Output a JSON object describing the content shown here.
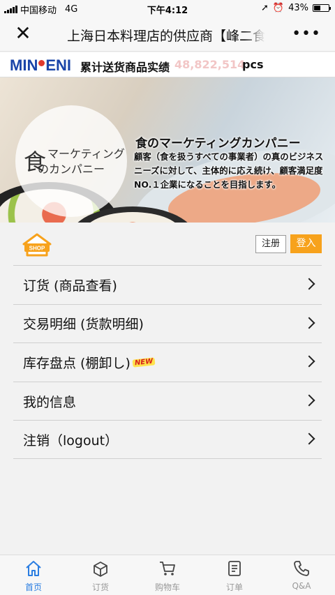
{
  "status_bar": {
    "carrier": "中国移动",
    "network": "4G",
    "time": "下午4:12",
    "battery": "43%",
    "battery_level": 0.43
  },
  "nav": {
    "title": "上海日本料理店的供应商【峰二食"
  },
  "brand": {
    "logo": "MINENI",
    "delivered_label": "累计送货商品实绩",
    "delivered_count": "48,822,514",
    "delivered_unit": "pcs"
  },
  "banner": {
    "circle_text_kanji": "食",
    "circle_text_line1": "マーケティング",
    "circle_text_line2": "のカンパニー",
    "headline": "食のマーケティングカンパニー",
    "description": "顧客（食を扱うすべての事業者）の真のビジネスニーズに対して、主体的に応え続け、顧客満足度NO.１企業になることを目指します。"
  },
  "shop": {
    "icon_label": "SHOP",
    "register": "注册",
    "login": "登入"
  },
  "menu": {
    "items": [
      {
        "label": "订货 (商品查看)"
      },
      {
        "label": "交易明细 (货款明细)"
      },
      {
        "label": "库存盘点 (棚卸し)",
        "badge": "NEW"
      },
      {
        "label": "我的信息"
      },
      {
        "label": "注销（logout）"
      }
    ]
  },
  "tabs": [
    {
      "label": "首页",
      "icon": "home-icon",
      "active": true
    },
    {
      "label": "订货",
      "icon": "box-icon"
    },
    {
      "label": "购物车",
      "icon": "cart-icon"
    },
    {
      "label": "订单",
      "icon": "order-icon"
    },
    {
      "label": "Q&A",
      "icon": "phone-icon"
    }
  ],
  "colors": {
    "accent": "#2a7de1",
    "login_button": "#f7a21c",
    "logo_blue": "#1a44a8",
    "logo_red": "#e03a2e"
  }
}
